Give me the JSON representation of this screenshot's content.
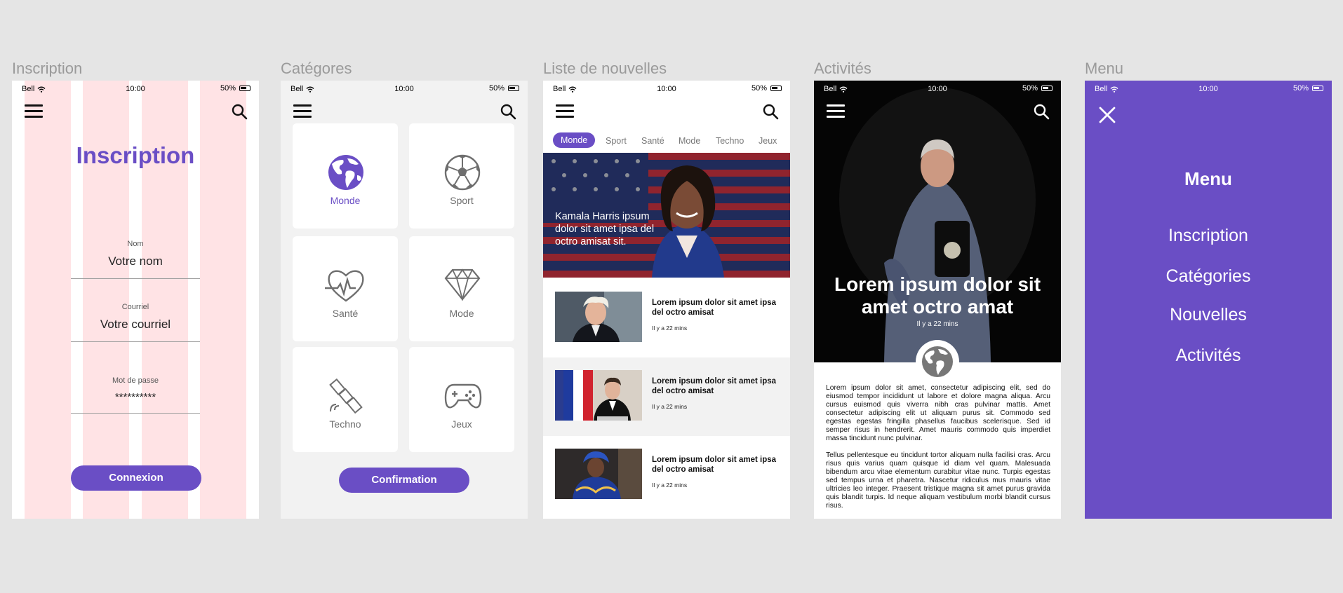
{
  "frames": {
    "inscription": "Inscription",
    "categories": "Catégores",
    "news": "Liste de nouvelles",
    "activities": "Activités",
    "menu": "Menu"
  },
  "status": {
    "carrier": "Bell",
    "time": "10:00",
    "battery": "50%"
  },
  "inscription": {
    "title": "Inscription",
    "name_label": "Nom",
    "name_value": "Votre nom",
    "email_label": "Courriel",
    "email_value": "Votre courriel",
    "password_label": "Mot de passe",
    "password_value": "**********",
    "submit": "Connexion"
  },
  "categories": {
    "items": [
      {
        "label": "Monde",
        "icon": "globe-icon",
        "active": true
      },
      {
        "label": "Sport",
        "icon": "soccer-ball-icon"
      },
      {
        "label": "Santé",
        "icon": "heartbeat-icon"
      },
      {
        "label": "Mode",
        "icon": "diamond-icon"
      },
      {
        "label": "Techno",
        "icon": "satellite-icon"
      },
      {
        "label": "Jeux",
        "icon": "gamepad-icon"
      }
    ],
    "confirm": "Confirmation"
  },
  "news": {
    "tabs": [
      "Monde",
      "Sport",
      "Santé",
      "Mode",
      "Techno",
      "Jeux"
    ],
    "hero_caption": "Kamala Harris ipsum dolor sit amet ipsa del octro amisat sit.",
    "items": [
      {
        "title": "Lorem ipsum dolor sit amet ipsa del octro amisat",
        "time": "Il y a 22 mins"
      },
      {
        "title": "Lorem ipsum dolor sit amet ipsa del octro amisat",
        "time": "Il y a 22 mins"
      },
      {
        "title": "Lorem ipsum dolor sit amet ipsa del octro amisat",
        "time": "Il y a 22 mins"
      }
    ]
  },
  "activities": {
    "title": "Lorem ipsum dolor sit amet octro amat",
    "time": "Il y a 22 mins",
    "paragraph1": "Lorem ipsum dolor sit amet, consectetur adipiscing elit, sed do eiusmod tempor incididunt ut labore et dolore magna aliqua. Arcu cursus euismod quis viverra nibh cras pulvinar mattis. Amet consectetur adipiscing elit ut aliquam purus sit. Commodo sed egestas egestas fringilla phasellus faucibus scelerisque. Sed id semper risus in hendrerit. Amet mauris commodo quis imperdiet massa tincidunt nunc pulvinar.",
    "paragraph2": "Tellus pellentesque eu tincidunt tortor aliquam nulla facilisi cras. Arcu risus quis varius quam quisque id diam vel quam. Malesuada bibendum arcu vitae elementum curabitur vitae nunc. Turpis egestas sed tempus urna et pharetra. Nascetur ridiculus mus mauris vitae ultricies leo integer. Praesent tristique magna sit amet purus gravida quis blandit turpis. Id neque aliquam vestibulum morbi blandit cursus risus."
  },
  "menu": {
    "title": "Menu",
    "items": [
      "Inscription",
      "Catégories",
      "Nouvelles",
      "Activités"
    ]
  },
  "colors": {
    "accent": "#6a4ec5",
    "grid_stripe": "#ffe3e5"
  }
}
